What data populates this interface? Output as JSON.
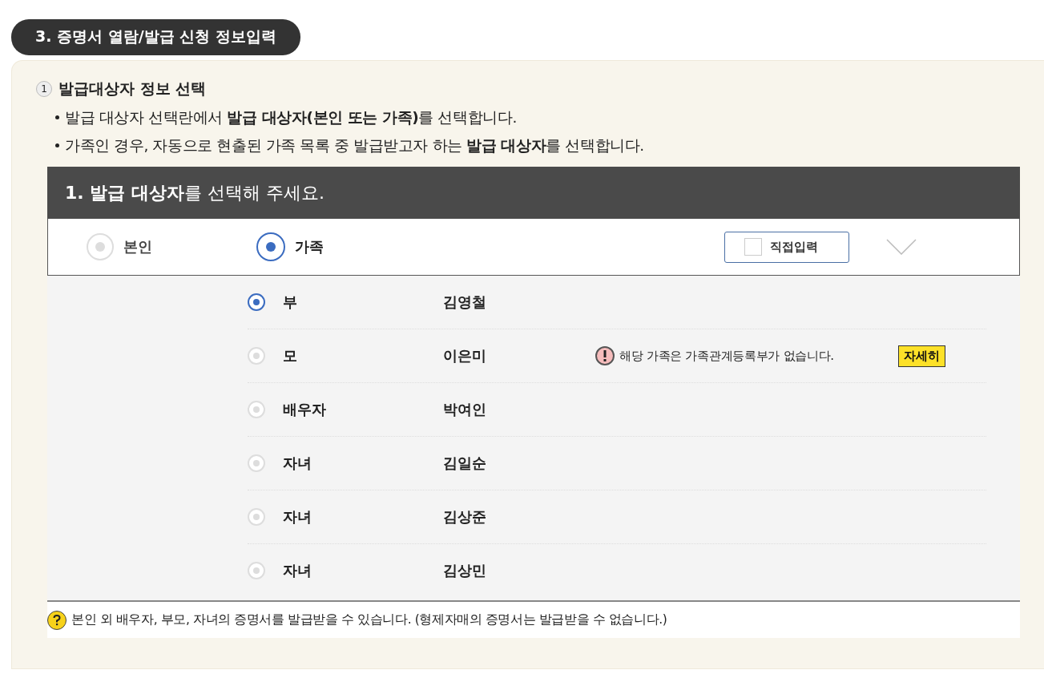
{
  "section_title": "3. 증명서 열람/발급 신청 정보입력",
  "step": {
    "number": "1",
    "title": "발급대상자 정보 선택"
  },
  "bullets": [
    "발급 대상자 선택란에서 **발급 대상자(본인 또는 가족)**를 선택합니다.",
    "가족인 경우, 자동으로 현출된 가족 목록 중 발급받고자 하는 **발급 대상자**를 선택합니다."
  ],
  "form": {
    "heading": "**1. 발급 대상자**를 선택해 주세요.",
    "target_options": [
      {
        "label": "본인",
        "selected": false
      },
      {
        "label": "가족",
        "selected": true
      }
    ],
    "direct_input": {
      "label": "직접입력",
      "checked": false
    },
    "family": [
      {
        "relation": "부",
        "name": "김영철",
        "selected": true
      },
      {
        "relation": "모",
        "name": "이은미",
        "selected": false,
        "notice": "해당 가족은 가족관계등록부가 없습니다.",
        "detail_button": "자세히"
      },
      {
        "relation": "배우자",
        "name": "박여인",
        "selected": false
      },
      {
        "relation": "자녀",
        "name": "김일순",
        "selected": false
      },
      {
        "relation": "자녀",
        "name": "김상준",
        "selected": false
      },
      {
        "relation": "자녀",
        "name": "김상민",
        "selected": false
      }
    ],
    "help": "본인 외 배우자, 부모, 자녀의 증명서를 발급받을 수 있습니다. (형제자매의 증명서는 발급받을 수 없습니다.)"
  }
}
